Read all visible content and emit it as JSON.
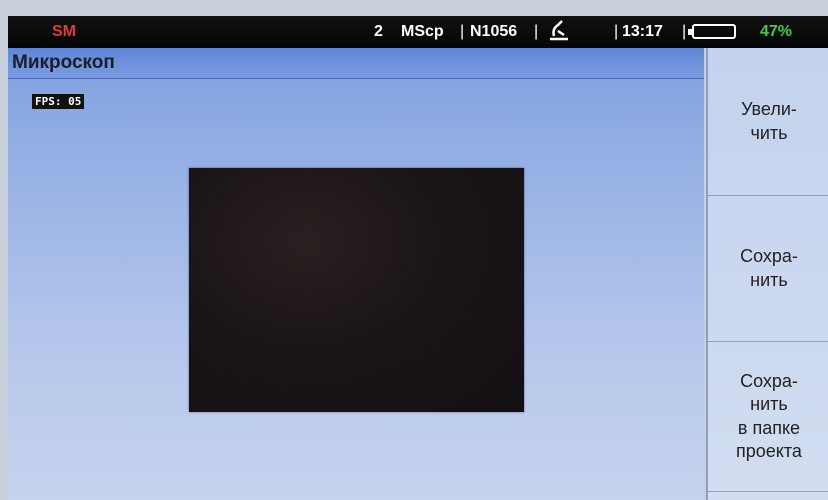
{
  "status_bar": {
    "app_code": "SM",
    "channel_count": "2",
    "mode": "MScp",
    "separator": "|",
    "fiber_id": "N1056",
    "probe_icon": "microscope-probe-icon",
    "time": "13:17",
    "battery_icon": "battery-icon",
    "battery_percent": "47%",
    "colors": {
      "app_code": "#e23a3a",
      "battery_percent": "#39d04a"
    }
  },
  "view": {
    "title": "Микроскоп",
    "fps": "FPS: 05"
  },
  "side_panel": {
    "zoom_label": "Увели-\nчить",
    "save_label": "Сохра-\nнить",
    "save_project_label": "Сохра-\nнить\nв папке\nпроекта"
  }
}
